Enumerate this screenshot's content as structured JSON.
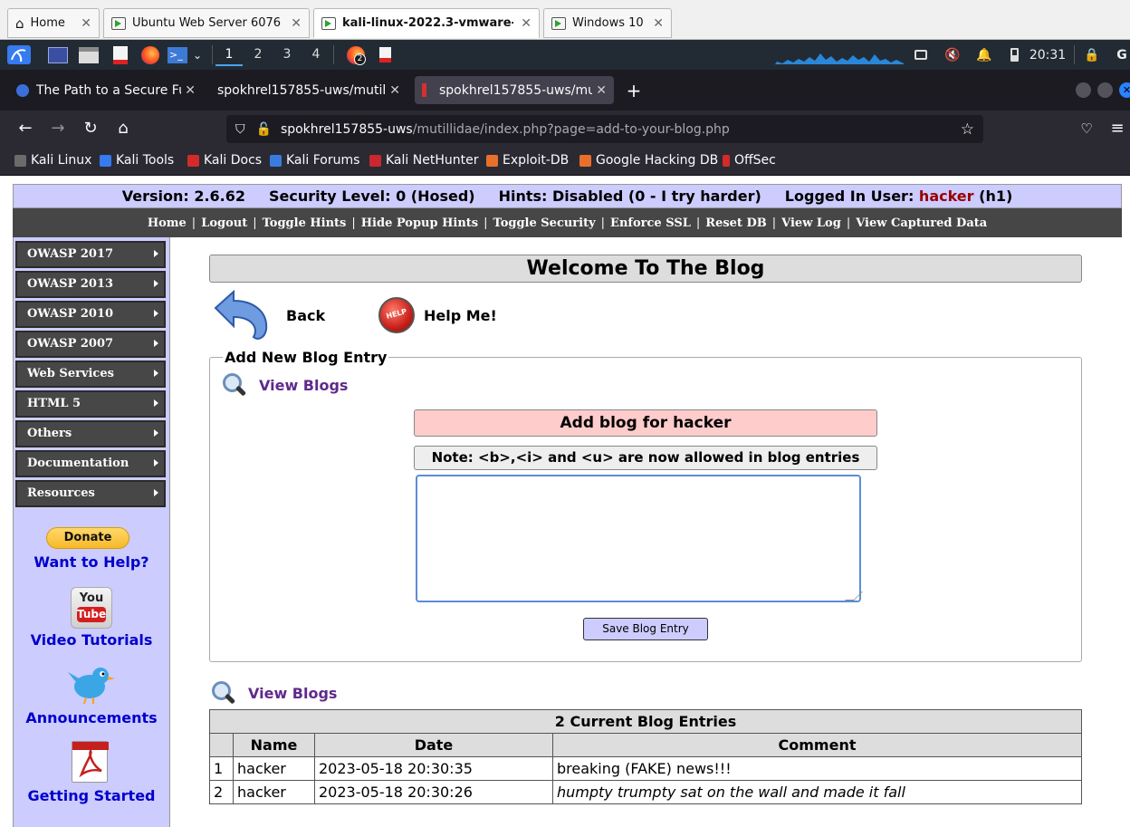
{
  "vm_tabs": [
    {
      "label": "Home",
      "active": false
    },
    {
      "label": "Ubuntu Web Server 6076",
      "active": false
    },
    {
      "label": "kali-linux-2022.3-vmware-a...",
      "active": true
    },
    {
      "label": "Windows 10",
      "active": false
    }
  ],
  "panel": {
    "workspaces": [
      "1",
      "2",
      "3",
      "4"
    ],
    "active_workspace": "1",
    "badge": "2",
    "time": "20:31",
    "edge_letter": "G"
  },
  "browser": {
    "tabs": [
      {
        "label": "The Path to a Secure Futu",
        "active": false
      },
      {
        "label": "spokhrel157855-uws/mutillid",
        "active": false
      },
      {
        "label": "spokhrel157855-uws/mut",
        "active": true
      }
    ],
    "url_host": "spokhrel157855-uws",
    "url_path": "/mutillidae/index.php?page=add-to-your-blog.php",
    "bookmarks": [
      "Kali Linux",
      "Kali Tools",
      "Kali Docs",
      "Kali Forums",
      "Kali NetHunter",
      "Exploit-DB",
      "Google Hacking DB",
      "OffSec"
    ]
  },
  "header": {
    "version": "Version: 2.6.62",
    "security": "Security Level: 0 (Hosed)",
    "hints": "Hints: Disabled (0 - I try harder)",
    "logged_in_prefix": "Logged In User:",
    "user": "hacker",
    "user_suffix": "(h1)"
  },
  "menu": [
    "Home",
    "Logout",
    "Toggle Hints",
    "Hide Popup Hints",
    "Toggle Security",
    "Enforce SSL",
    "Reset DB",
    "View Log",
    "View Captured Data"
  ],
  "sidebar": {
    "items": [
      "OWASP 2017",
      "OWASP 2013",
      "OWASP 2010",
      "OWASP 2007",
      "Web Services",
      "HTML 5",
      "Others",
      "Documentation",
      "Resources"
    ],
    "donate": "Donate",
    "want_help": "Want to Help?",
    "youtube_top": "You",
    "youtube_bottom": "Tube",
    "video_tutorials": "Video Tutorials",
    "announcements": "Announcements",
    "getting_started": "Getting Started"
  },
  "main": {
    "title": "Welcome To The Blog",
    "back": "Back",
    "help_me": "Help Me!",
    "help_badge": "HELP",
    "legend": "Add New Blog Entry",
    "view_blogs": "View Blogs",
    "add_blog": "Add blog for hacker",
    "note": "Note: <b>,<i> and <u> are now allowed in blog entries",
    "textarea_value": "",
    "save_button": "Save Blog Entry",
    "view_blogs_2": "View Blogs"
  },
  "blog_table": {
    "caption": "2 Current Blog Entries",
    "headers": [
      "",
      "Name",
      "Date",
      "Comment"
    ],
    "rows": [
      {
        "num": "1",
        "name": "hacker",
        "date": "2023-05-18 20:30:35",
        "comment": "breaking (FAKE) news!!!",
        "italic": false
      },
      {
        "num": "2",
        "name": "hacker",
        "date": "2023-05-18 20:30:26",
        "comment": "humpty trumpty sat on the wall and made it fall",
        "italic": true
      }
    ]
  }
}
